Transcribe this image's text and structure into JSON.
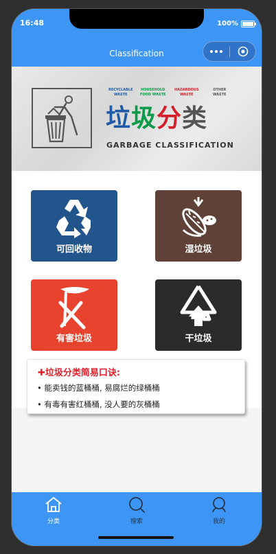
{
  "status_bar": {
    "time": "16:48",
    "battery": "100%"
  },
  "nav": {
    "title": "Classification"
  },
  "banner": {
    "title_chars": [
      "垃",
      "圾",
      "分",
      "类"
    ],
    "subtitle": "GARBAGE CLASSIFICATION",
    "categories": [
      {
        "line1": "RECYCLABLE",
        "line2": "WASTE",
        "color": "#1e5aa6"
      },
      {
        "line1": "HOUSEHOLD",
        "line2": "FOOD WASTE",
        "color": "#0d9a49"
      },
      {
        "line1": "HAZARDOUS",
        "line2": "WASTE",
        "color": "#d3202a"
      },
      {
        "line1": "OTHER",
        "line2": "WASTE",
        "color": "#555555"
      }
    ]
  },
  "cards": [
    {
      "label": "可回收物",
      "icon": "recycle-icon",
      "color": "#23558d"
    },
    {
      "label": "湿垃圾",
      "icon": "food-waste-icon",
      "color": "#5f4138"
    },
    {
      "label": "有害垃圾",
      "icon": "hazardous-icon",
      "color": "#e8432f"
    },
    {
      "label": "干垃圾",
      "icon": "residual-waste-icon",
      "color": "#2b2b2b"
    }
  ],
  "tips": {
    "title": "✚垃圾分类简易口诀:",
    "lines": [
      "• 能卖钱的蓝桶桶, 易腐烂的绿桶桶",
      "• 有毒有害红桶桶, 没人要的灰桶桶"
    ]
  },
  "tabbar": {
    "items": [
      {
        "label": "分类",
        "icon": "home-icon",
        "active": true
      },
      {
        "label": "搜索",
        "icon": "search-icon",
        "active": false
      },
      {
        "label": "我的",
        "icon": "user-icon",
        "active": false
      }
    ],
    "active_color": "#ffffff",
    "inactive_color": "#27364a"
  },
  "colors": {
    "primary": "#3d96f5",
    "tip_title": "#e6202a"
  }
}
